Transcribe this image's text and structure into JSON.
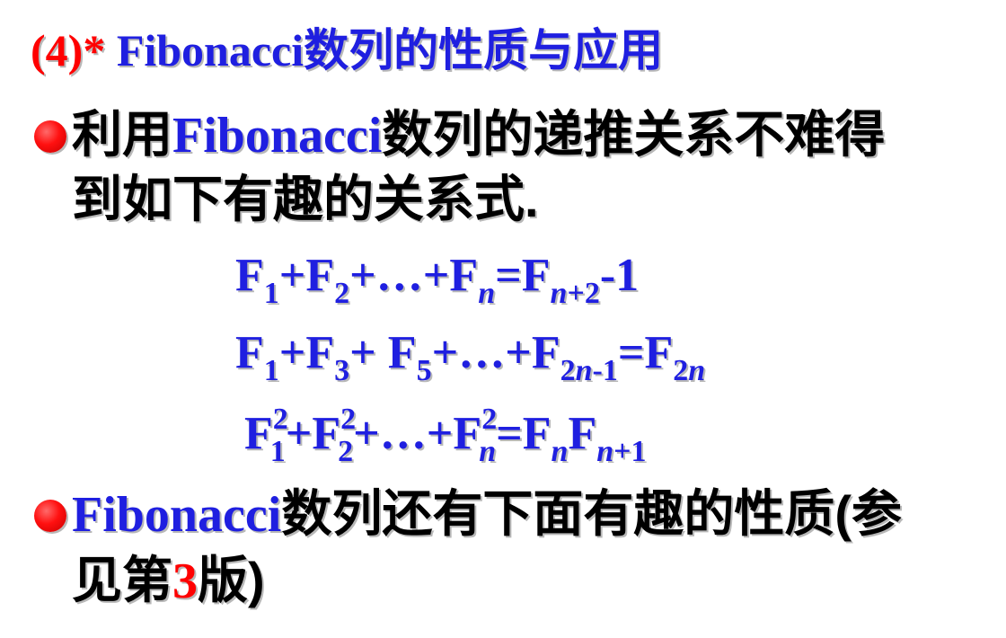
{
  "title": {
    "number": "(4)",
    "star": "*",
    "name": "Fibonacci",
    "text": "数列的性质与应用"
  },
  "bullet1": {
    "prefix": "利用",
    "name": "Fibonacci",
    "line1_rest": "数列的递推关系不难得",
    "line2": "到如下有趣的关系式."
  },
  "formulas": [
    "F₁+F₂+…+Fₙ=Fₙ₊₂-1",
    "F₁+F₃+ F₅+…+F₂ₙ₋₁=F₂ₙ",
    "F²₁+F²₂+…+F²ₙ=FₙFₙ₊₁"
  ],
  "bullet2": {
    "name": "Fibonacci",
    "line1_rest": "数列还有下面有趣的性质(参",
    "line2_a": "见第",
    "line2_num": "3",
    "line2_b": "版)"
  },
  "colors": {
    "accent": "#1f1fe0",
    "highlight": "#ff0000",
    "text": "#000000"
  }
}
